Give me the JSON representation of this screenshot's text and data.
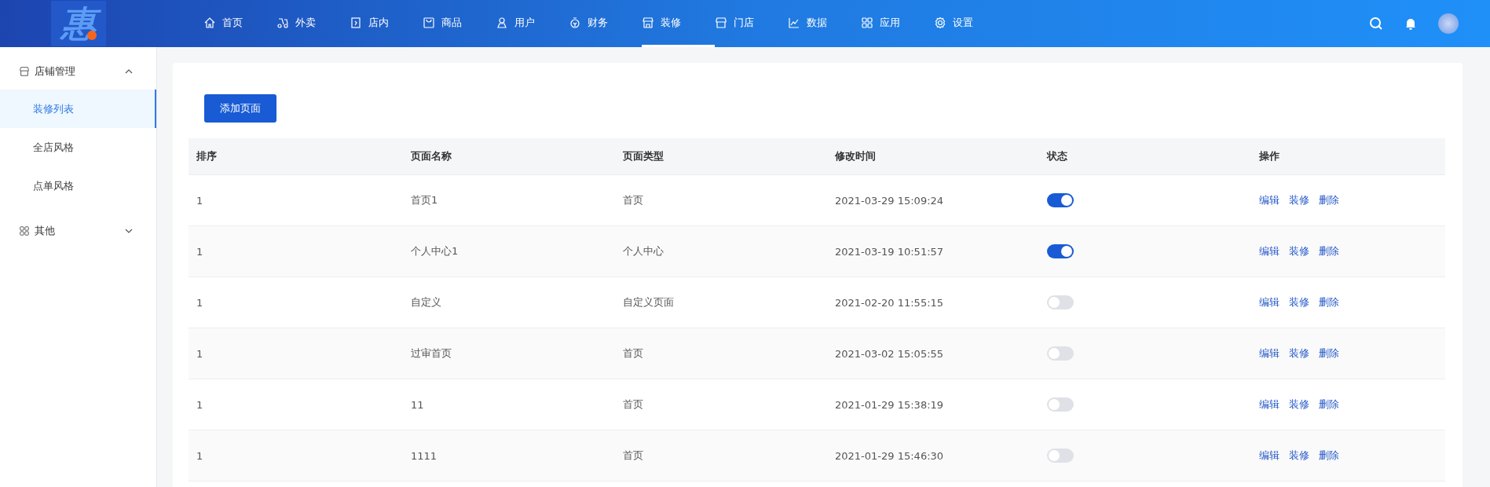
{
  "logo": {
    "text": "惠"
  },
  "nav": [
    {
      "label": "首页",
      "selected": false
    },
    {
      "label": "外卖",
      "selected": false
    },
    {
      "label": "店内",
      "selected": false
    },
    {
      "label": "商品",
      "selected": false
    },
    {
      "label": "用户",
      "selected": false
    },
    {
      "label": "财务",
      "selected": false
    },
    {
      "label": "装修",
      "selected": true
    },
    {
      "label": "门店",
      "selected": false
    },
    {
      "label": "数据",
      "selected": false
    },
    {
      "label": "应用",
      "selected": false
    },
    {
      "label": "设置",
      "selected": false
    }
  ],
  "sidebar": {
    "groups": [
      {
        "label": "店铺管理",
        "expanded": true,
        "children": [
          {
            "label": "装修列表",
            "selected": true
          },
          {
            "label": "全店风格",
            "selected": false
          },
          {
            "label": "点单风格",
            "selected": false
          }
        ]
      },
      {
        "label": "其他",
        "expanded": false
      }
    ]
  },
  "add_button": "添加页面",
  "table": {
    "columns": [
      "排序",
      "页面名称",
      "页面类型",
      "修改时间",
      "状态",
      "操作"
    ],
    "rows": [
      {
        "order": "1",
        "name": "首页1",
        "type": "首页",
        "modified": "2021-03-29 15:09:24",
        "on": true,
        "actions": [
          "编辑",
          "装修",
          "删除"
        ]
      },
      {
        "order": "1",
        "name": "个人中心1",
        "type": "个人中心",
        "modified": "2021-03-19 10:51:57",
        "on": true,
        "actions": [
          "编辑",
          "装修",
          "删除"
        ]
      },
      {
        "order": "1",
        "name": "自定义",
        "type": "自定义页面",
        "modified": "2021-02-20 11:55:15",
        "on": false,
        "actions": [
          "编辑",
          "装修",
          "删除"
        ]
      },
      {
        "order": "1",
        "name": "过审首页",
        "type": "首页",
        "modified": "2021-03-02 15:05:55",
        "on": false,
        "actions": [
          "编辑",
          "装修",
          "删除"
        ]
      },
      {
        "order": "1",
        "name": "11",
        "type": "首页",
        "modified": "2021-01-29 15:38:19",
        "on": false,
        "actions": [
          "编辑",
          "装修",
          "删除"
        ]
      },
      {
        "order": "1",
        "name": "1111",
        "type": "首页",
        "modified": "2021-01-29 15:46:30",
        "on": false,
        "actions": [
          "编辑",
          "装修",
          "删除"
        ]
      }
    ]
  }
}
